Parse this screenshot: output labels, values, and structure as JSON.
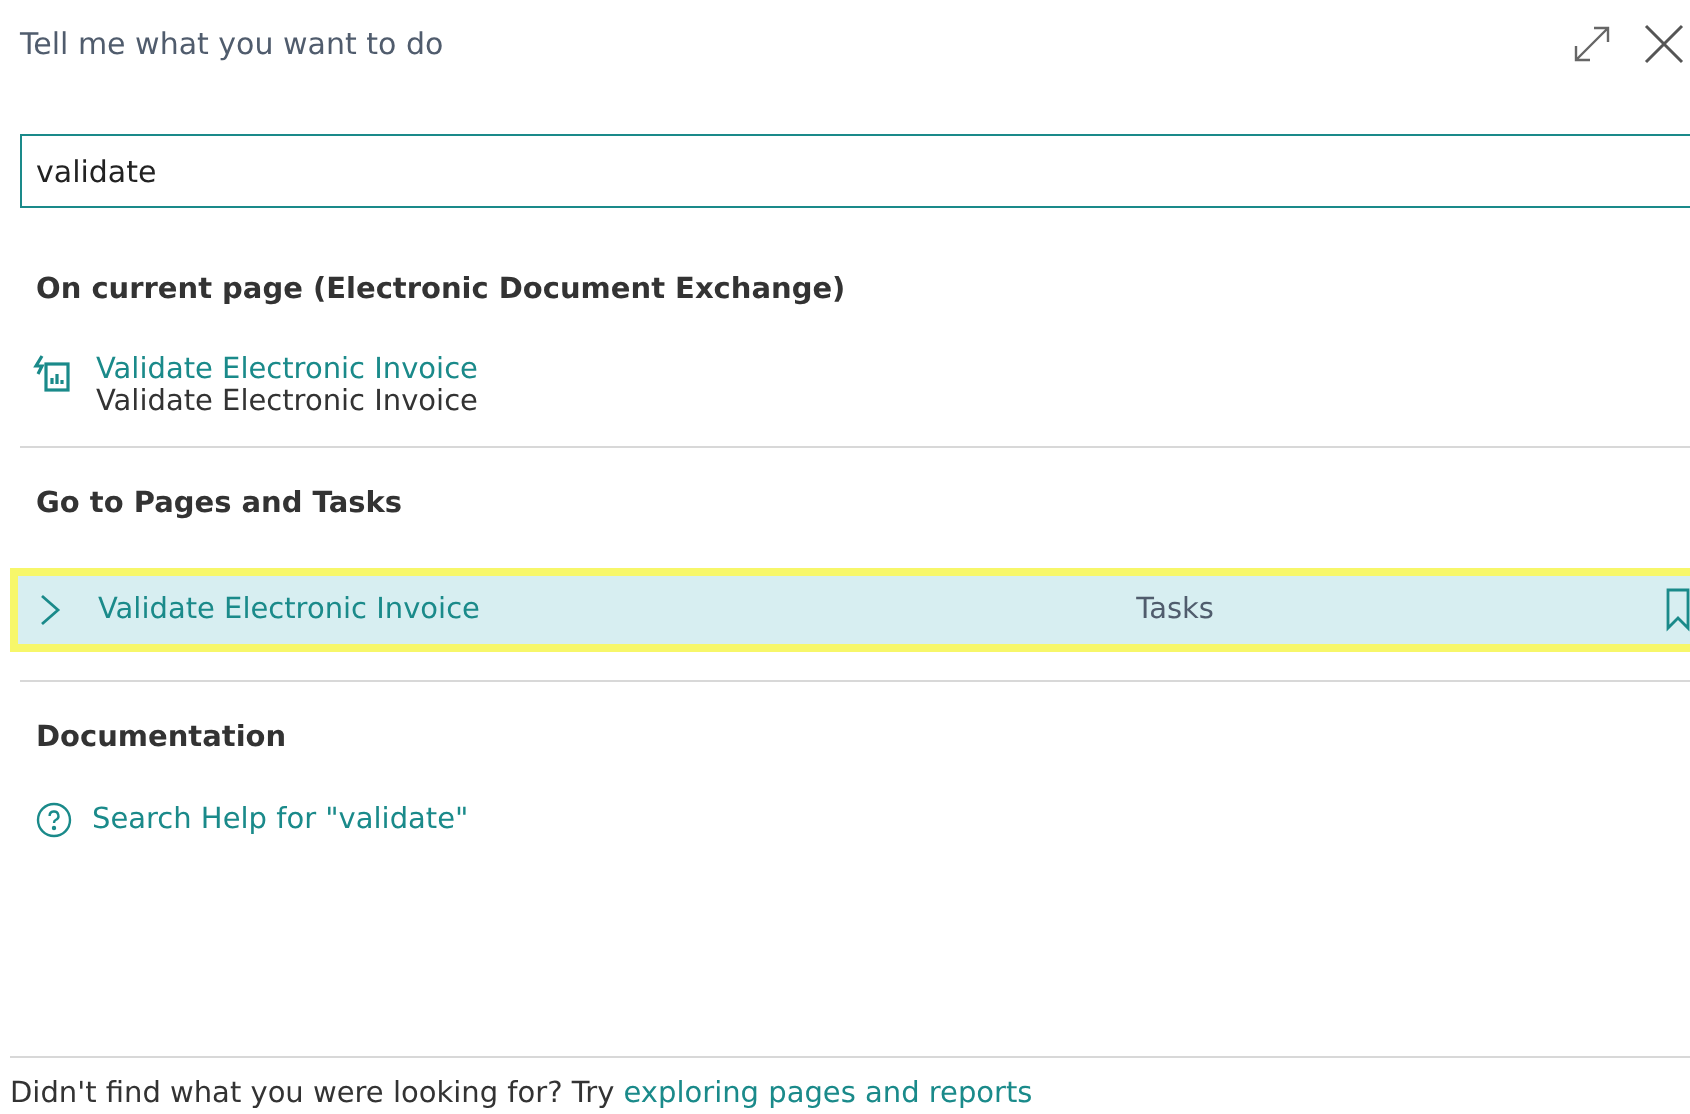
{
  "header": {
    "title": "Tell me what you want to do"
  },
  "search": {
    "value": "validate"
  },
  "sections": [
    {
      "kind": "actions",
      "title": "On current page (Electronic Document Exchange)",
      "items": [
        {
          "title": "Validate Electronic Invoice",
          "subtitle": "Validate Electronic Invoice"
        }
      ]
    },
    {
      "kind": "pages",
      "title": "Go to Pages and Tasks",
      "items": [
        {
          "title": "Validate Electronic Invoice",
          "category": "Tasks",
          "selected": true
        }
      ]
    },
    {
      "kind": "help",
      "title": "Documentation",
      "items": [
        {
          "title": "Search Help for \"validate\""
        }
      ]
    }
  ],
  "footer": {
    "text": "Didn't find what you were looking for? Try",
    "link": "exploring pages and reports"
  }
}
